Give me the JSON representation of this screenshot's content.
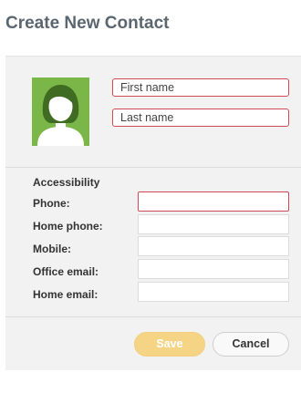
{
  "header": {
    "title": "Create New Contact"
  },
  "contact": {
    "avatar_icon": "person-silhouette-icon",
    "first_name_placeholder": "First name",
    "last_name_placeholder": "Last name"
  },
  "accessibility": {
    "section_label": "Accessibility",
    "fields": {
      "phone": {
        "label": "Phone:",
        "value": ""
      },
      "home_phone": {
        "label": "Home phone:",
        "value": ""
      },
      "mobile": {
        "label": "Mobile:",
        "value": ""
      },
      "office_email": {
        "label": "Office email:",
        "value": ""
      },
      "home_email": {
        "label": "Home email:",
        "value": ""
      }
    }
  },
  "actions": {
    "save_label": "Save",
    "cancel_label": "Cancel"
  },
  "colors": {
    "title": "#5b6770",
    "panel_bg": "#f2f2f2",
    "avatar_bg": "#7ab648",
    "required_border": "#d04b56",
    "save_button": "#f6d485"
  }
}
